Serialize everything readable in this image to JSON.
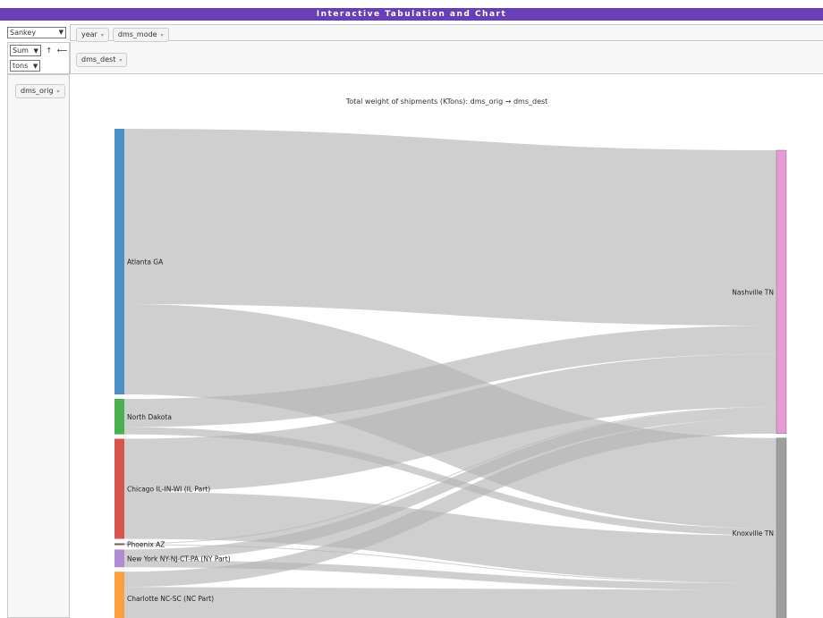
{
  "app": {
    "title": "Interactive Tabulation and Chart"
  },
  "controls": {
    "renderer": "Sankey",
    "aggregator": "Sum",
    "value_field": "tons",
    "sort_rows": "↑",
    "sort_cols": "⟵"
  },
  "cols_fields": [
    "year",
    "dms_mode"
  ],
  "rows_fields_top": [
    "dms_dest"
  ],
  "rows_fields_left": [
    "dms_orig"
  ],
  "pill_arrow": "▾",
  "chart_data": {
    "type": "sankey",
    "title": "Total weight of shipments (KTons): dms_orig  →  dms_dest",
    "sources": [
      {
        "name": "Atlanta GA",
        "color": "#4e8fc6",
        "total": 300
      },
      {
        "name": "North Dakota",
        "color": "#4caf50",
        "total": 40
      },
      {
        "name": "Chicago IL-IN-WI (IL Part)",
        "color": "#d9534f",
        "total": 113
      },
      {
        "name": "Phoenix AZ",
        "color": "#8c564b",
        "total": 2
      },
      {
        "name": "New York NY-NJ-CT-PA (NY Part)",
        "color": "#b08cd0",
        "total": 20
      },
      {
        "name": "Charlotte NC-SC (NC Part)",
        "color": "#ff9f3a",
        "total": 60
      }
    ],
    "targets": [
      {
        "name": "Nashville TN",
        "color": "#e79ad3",
        "total": 320
      },
      {
        "name": "Knoxville TN",
        "color": "#9e9e9e",
        "total": 215
      }
    ],
    "links": [
      {
        "source": "Atlanta GA",
        "target": "Nashville TN",
        "value": 198
      },
      {
        "source": "Atlanta GA",
        "target": "Knoxville TN",
        "value": 102
      },
      {
        "source": "North Dakota",
        "target": "Nashville TN",
        "value": 32
      },
      {
        "source": "North Dakota",
        "target": "Knoxville TN",
        "value": 8
      },
      {
        "source": "Chicago IL-IN-WI (IL Part)",
        "target": "Nashville TN",
        "value": 60
      },
      {
        "source": "Chicago IL-IN-WI (IL Part)",
        "target": "Knoxville TN",
        "value": 53
      },
      {
        "source": "Phoenix AZ",
        "target": "Nashville TN",
        "value": 1
      },
      {
        "source": "Phoenix AZ",
        "target": "Knoxville TN",
        "value": 1
      },
      {
        "source": "New York NY-NJ-CT-PA (NY Part)",
        "target": "Nashville TN",
        "value": 12
      },
      {
        "source": "New York NY-NJ-CT-PA (NY Part)",
        "target": "Knoxville TN",
        "value": 8
      },
      {
        "source": "Charlotte NC-SC (NC Part)",
        "target": "Nashville TN",
        "value": 17
      },
      {
        "source": "Charlotte NC-SC (NC Part)",
        "target": "Knoxville TN",
        "value": 43
      }
    ]
  }
}
